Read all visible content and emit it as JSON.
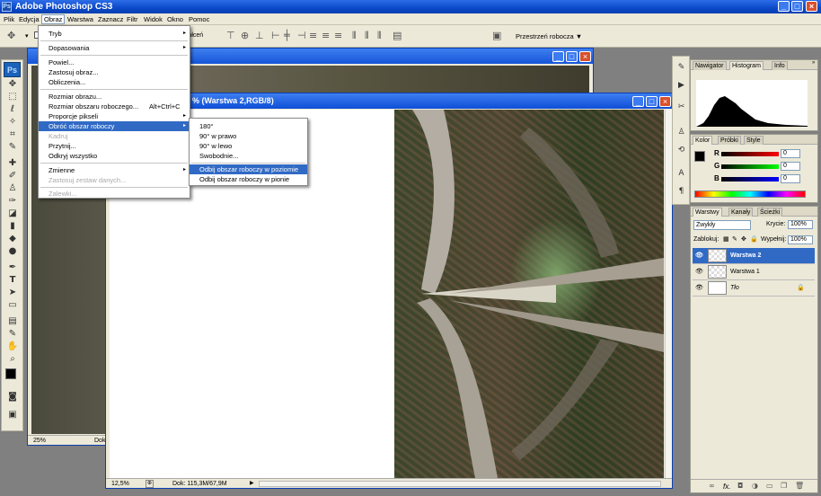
{
  "app": {
    "title": "Adobe Photoshop CS3",
    "ps_logo": "Ps",
    "ps_mini": "Ps"
  },
  "window_controls": {
    "minimize": "_",
    "maximize": "□",
    "close": "×"
  },
  "menubar": [
    "Plik",
    "Edycja",
    "Obraz",
    "Warstwa",
    "Zaznacz",
    "Filtr",
    "Widok",
    "Okno",
    "Pomoc"
  ],
  "options": {
    "partial_label": "kształceń",
    "workspace_label": "Przestrzeń robocza ▼"
  },
  "obraz_menu": [
    {
      "label": "Tryb",
      "arrow": "▸"
    },
    {
      "sep": true
    },
    {
      "label": "Dopasowania",
      "arrow": "▸"
    },
    {
      "sep": true
    },
    {
      "label": "Powiel..."
    },
    {
      "label": "Zastosuj obraz..."
    },
    {
      "label": "Obliczenia..."
    },
    {
      "sep": true
    },
    {
      "label": "Rozmiar obrazu..."
    },
    {
      "label": "Rozmiar obszaru roboczego...",
      "shortcut": "Alt+Ctrl+C"
    },
    {
      "label": "Proporcje pikseli",
      "arrow": "▸"
    },
    {
      "label": "Obróć obszar roboczy",
      "arrow": "▸",
      "highlight": true
    },
    {
      "label": "Kadruj",
      "disabled": true
    },
    {
      "label": "Przytnij..."
    },
    {
      "label": "Odkryj wszystko"
    },
    {
      "sep": true
    },
    {
      "label": "Zmienne",
      "arrow": "▸"
    },
    {
      "label": "Zastosuj zestaw danych...",
      "disabled": true
    },
    {
      "sep": true
    },
    {
      "label": "Zalewki...",
      "disabled": true
    }
  ],
  "rotate_submenu": [
    {
      "label": "180°"
    },
    {
      "label": "90° w prawo"
    },
    {
      "label": "90° w lewo"
    },
    {
      "label": "Swobodnie..."
    },
    {
      "sep": true
    },
    {
      "label": "Odbij obszar roboczy w poziomie",
      "highlight": true
    },
    {
      "label": "Odbij obszar roboczy w pionie"
    }
  ],
  "doc_back": {
    "zoom": "25%",
    "doc_label": "Dok:"
  },
  "doc_front": {
    "title": "% (Warstwa 2,RGB/8)",
    "zoom": "12,5%",
    "doc_info": "Dok: 115,3M/67,9M"
  },
  "panels": {
    "histogram_tabs": [
      "Nawigator",
      "Histogram",
      "Info"
    ],
    "color_tabs": [
      "Kolor",
      "Próbki",
      "Style"
    ],
    "color": {
      "channels": [
        {
          "label": "R",
          "value": "0"
        },
        {
          "label": "G",
          "value": "0"
        },
        {
          "label": "B",
          "value": "0"
        }
      ]
    },
    "layers_tabs": [
      "Warstwy",
      "Kanały",
      "Ścieżki"
    ],
    "blend_mode": "Zwykły",
    "opacity_label": "Krycie:",
    "opacity_value": "100%",
    "lock_label": "Zablokuj:",
    "fill_label": "Wypełnij:",
    "fill_value": "100%",
    "layers": [
      {
        "name": "Warstwa 2",
        "selected": true
      },
      {
        "name": "Warstwa 1",
        "selected": false
      },
      {
        "name": "Tło",
        "selected": false,
        "locked": true
      }
    ],
    "bottom_icons": [
      "link-icon",
      "fx-icon",
      "mask-icon",
      "adjustment-icon",
      "folder-icon",
      "new-layer-icon",
      "trash-icon"
    ]
  },
  "colors": {
    "titlebar": "#0b49c9",
    "menu_highlight": "#316ac5",
    "chrome": "#ece9d8"
  }
}
